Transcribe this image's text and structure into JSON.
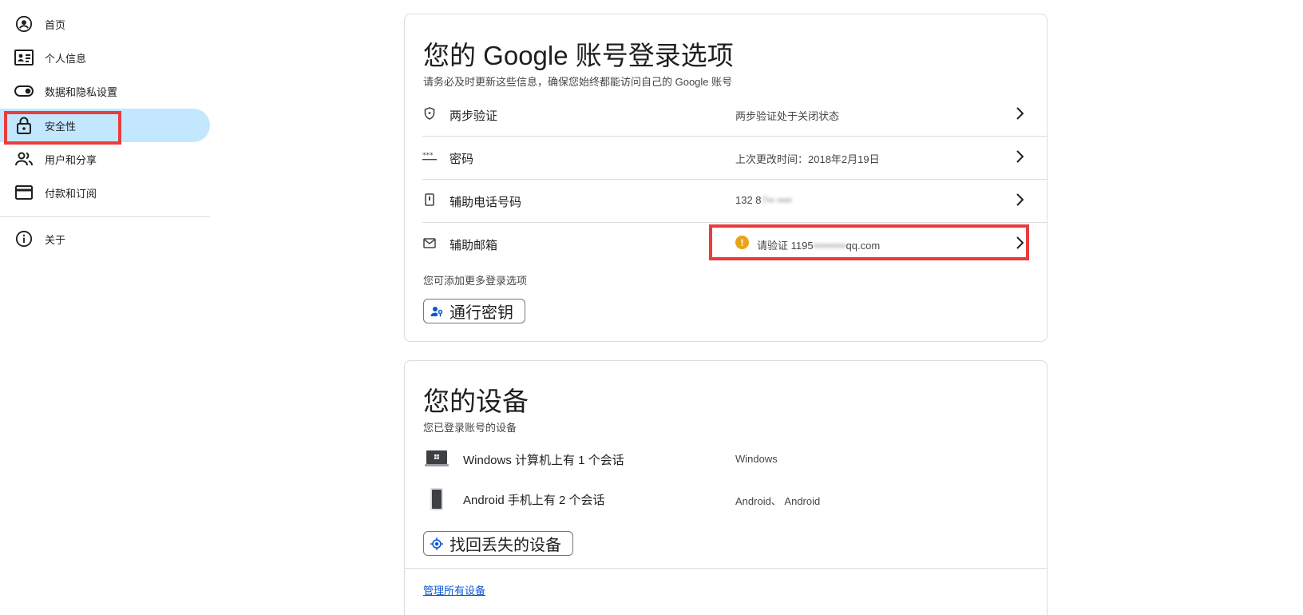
{
  "sidebar": {
    "items": [
      {
        "label": "首页",
        "icon": "account-circle-icon"
      },
      {
        "label": "个人信息",
        "icon": "id-card-icon"
      },
      {
        "label": "数据和隐私设置",
        "icon": "toggle-icon"
      },
      {
        "label": "安全性",
        "icon": "lock-icon",
        "active": true
      },
      {
        "label": "用户和分享",
        "icon": "people-icon"
      },
      {
        "label": "付款和订阅",
        "icon": "credit-card-icon"
      },
      {
        "label": "关于",
        "icon": "info-icon"
      }
    ]
  },
  "signin_options": {
    "title": "您的 Google 账号登录选项",
    "subtitle": "请务必及时更新这些信息，确保您始终都能访问自己的 Google 账号",
    "rows": [
      {
        "label": "两步验证",
        "value": "两步验证处于关闭状态",
        "icon": "shield-icon"
      },
      {
        "label": "密码",
        "value": "上次更改时间：2018年2月19日",
        "icon": "password-dots-icon"
      },
      {
        "label": "辅助电话号码",
        "value_prefix": "132 8",
        "value_blurred": "7•• ••••",
        "icon": "phone-icon"
      },
      {
        "label": "辅助邮箱",
        "value_prefix": "请验证 1195",
        "value_blurred": "•••••••••",
        "value_suffix": "qq.com",
        "icon": "mail-icon",
        "warning": "!"
      }
    ],
    "more_text": "您可添加更多登录选项",
    "passkey_button": "通行密钥"
  },
  "devices": {
    "title": "您的设备",
    "subtitle": "您已登录账号的设备",
    "rows": [
      {
        "label": "Windows 计算机上有 1 个会话",
        "value": "Windows",
        "icon": "windows-laptop-icon"
      },
      {
        "label": "Android 手机上有 2 个会话",
        "value": "Android、 Android",
        "icon": "android-phone-icon"
      }
    ],
    "find_button": "找回丢失的设备",
    "manage_link": "管理所有设备"
  },
  "colors": {
    "active_nav_bg": "#c2e7ff",
    "highlight_red": "#ea3c3c",
    "warning_orange": "#e8a317",
    "link_blue": "#0b57d0"
  }
}
